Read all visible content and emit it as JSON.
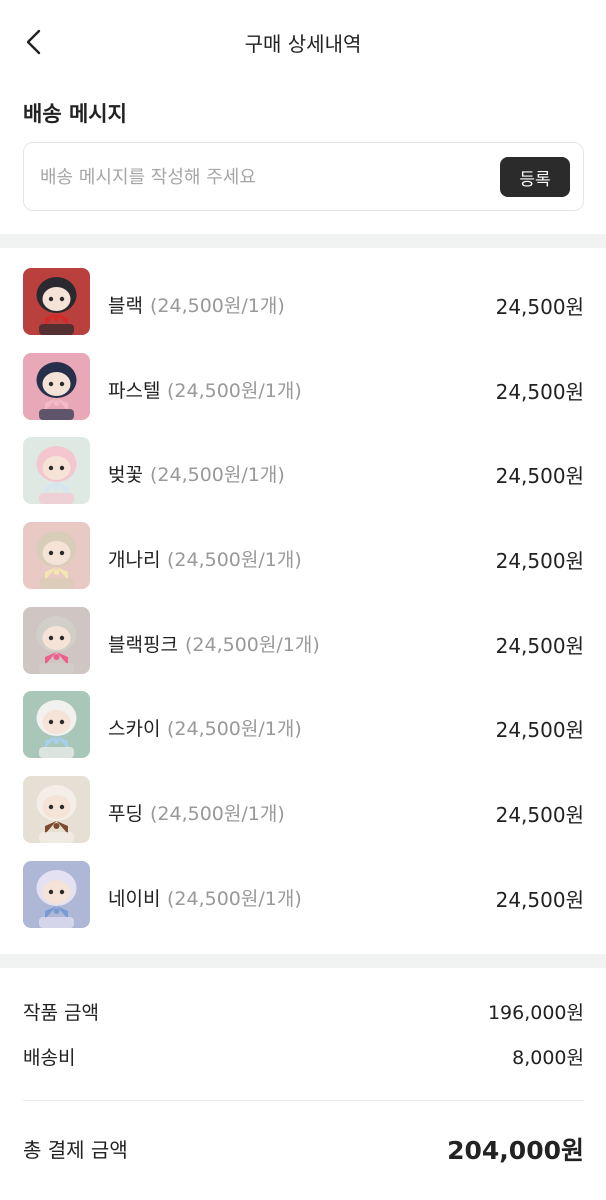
{
  "header": {
    "title": "구매 상세내역",
    "back_icon": "chevron-left-icon"
  },
  "delivery": {
    "section_title": "배송 메시지",
    "placeholder": "배송 메시지를 작성해 주세요",
    "value": "",
    "register_label": "등록"
  },
  "items": [
    {
      "name": "블랙",
      "detail": "(24,500원/1개)",
      "price": "24,500원",
      "thumb_bg": "#b9403c",
      "thumb_hair": "#2a2a2e",
      "thumb_accent": "#d42a2a"
    },
    {
      "name": "파스텔",
      "detail": "(24,500원/1개)",
      "price": "24,500원",
      "thumb_bg": "#e8a8b8",
      "thumb_hair": "#27304a",
      "thumb_accent": "#f3b9c8"
    },
    {
      "name": "벚꽃",
      "detail": "(24,500원/1개)",
      "price": "24,500원",
      "thumb_bg": "#dfe9e4",
      "thumb_hair": "#f4c6d0",
      "thumb_accent": "#d4e6f4"
    },
    {
      "name": "개나리",
      "detail": "(24,500원/1개)",
      "price": "24,500원",
      "thumb_bg": "#e9c9c4",
      "thumb_hair": "#d8cdb8",
      "thumb_accent": "#f3e6b0"
    },
    {
      "name": "블랙핑크",
      "detail": "(24,500원/1개)",
      "price": "24,500원",
      "thumb_bg": "#cfc5c2",
      "thumb_hair": "#d2cfc9",
      "thumb_accent": "#ee5f8d"
    },
    {
      "name": "스카이",
      "detail": "(24,500원/1개)",
      "price": "24,500원",
      "thumb_bg": "#a9c7b8",
      "thumb_hair": "#f2f1ef",
      "thumb_accent": "#a7cfe9"
    },
    {
      "name": "푸딩",
      "detail": "(24,500원/1개)",
      "price": "24,500원",
      "thumb_bg": "#e6dfd4",
      "thumb_hair": "#f3efe8",
      "thumb_accent": "#7c4a2e"
    },
    {
      "name": "네이비",
      "detail": "(24,500원/1개)",
      "price": "24,500원",
      "thumb_bg": "#aeb7d6",
      "thumb_hair": "#e4e1f3",
      "thumb_accent": "#7a9ad4"
    }
  ],
  "summary": {
    "product_label": "작품 금액",
    "product_value": "196,000원",
    "shipping_label": "배송비",
    "shipping_value": "8,000원",
    "total_label": "총 결제 금액",
    "total_value": "204,000원"
  }
}
